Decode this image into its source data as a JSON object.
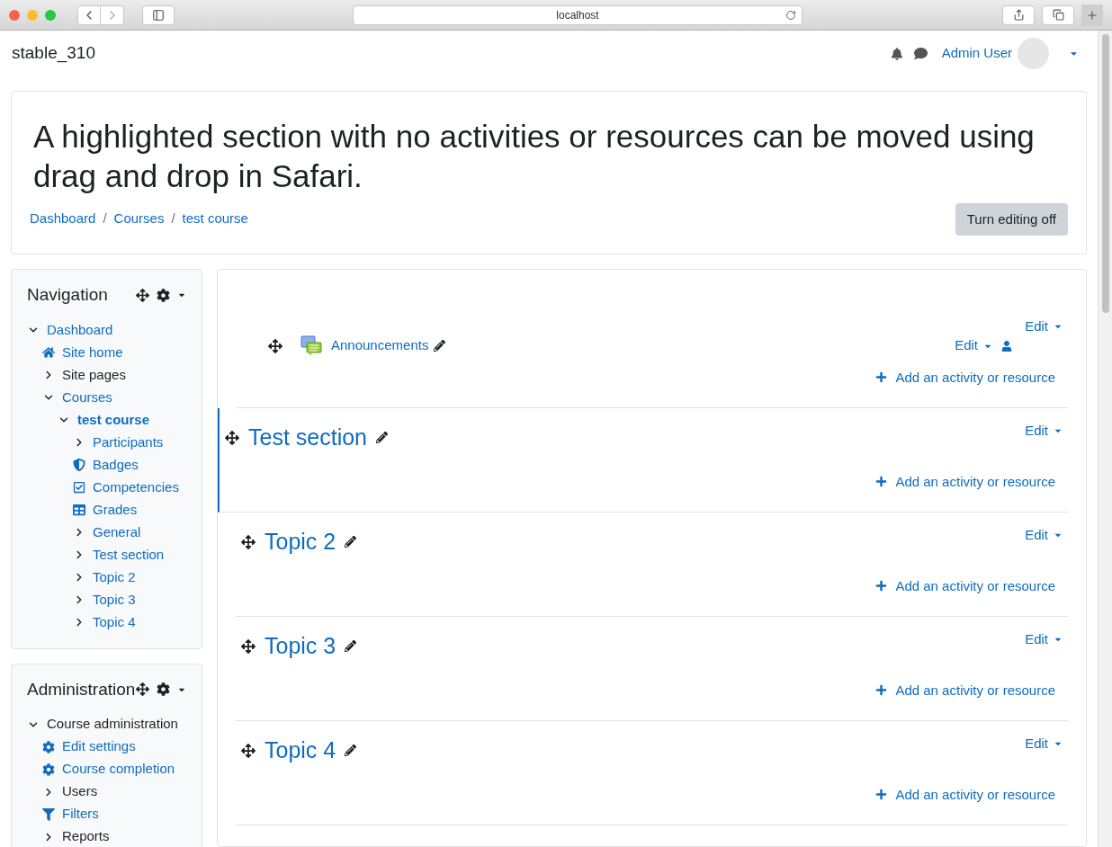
{
  "browser": {
    "address": "localhost"
  },
  "navbar": {
    "site_name": "stable_310",
    "user_name": "Admin User"
  },
  "header": {
    "title": "A highlighted section with no activities or resources can be moved using drag and drop in Safari.",
    "breadcrumbs": [
      "Dashboard",
      "Courses",
      "test course"
    ],
    "breadcrumb_separator": "/",
    "edit_button": "Turn editing off"
  },
  "navigation_block": {
    "title": "Navigation",
    "items": [
      {
        "label": "Dashboard",
        "kind": "branch",
        "expanded": true,
        "link": true,
        "current": false,
        "children": [
          {
            "label": "Site home",
            "kind": "home",
            "link": true,
            "current": false
          },
          {
            "label": "Site pages",
            "kind": "branch",
            "expanded": false,
            "link": false,
            "current": false
          },
          {
            "label": "Courses",
            "kind": "branch",
            "expanded": true,
            "link": true,
            "current": false,
            "children": [
              {
                "label": "test course",
                "kind": "branch",
                "expanded": true,
                "link": true,
                "current": true,
                "children": [
                  {
                    "label": "Participants",
                    "kind": "branch",
                    "expanded": false,
                    "link": true,
                    "current": false
                  },
                  {
                    "label": "Badges",
                    "kind": "badge",
                    "link": true,
                    "current": false
                  },
                  {
                    "label": "Competencies",
                    "kind": "check",
                    "link": true,
                    "current": false
                  },
                  {
                    "label": "Grades",
                    "kind": "table",
                    "link": true,
                    "current": false
                  },
                  {
                    "label": "General",
                    "kind": "branch",
                    "expanded": false,
                    "link": true,
                    "current": false
                  },
                  {
                    "label": "Test section",
                    "kind": "branch",
                    "expanded": false,
                    "link": true,
                    "current": false
                  },
                  {
                    "label": "Topic 2",
                    "kind": "branch",
                    "expanded": false,
                    "link": true,
                    "current": false
                  },
                  {
                    "label": "Topic 3",
                    "kind": "branch",
                    "expanded": false,
                    "link": true,
                    "current": false
                  },
                  {
                    "label": "Topic 4",
                    "kind": "branch",
                    "expanded": false,
                    "link": true,
                    "current": false
                  }
                ]
              }
            ]
          }
        ]
      }
    ]
  },
  "administration_block": {
    "title": "Administration",
    "items": [
      {
        "label": "Course administration",
        "kind": "branch",
        "expanded": true,
        "link": false,
        "current": false,
        "children": [
          {
            "label": "Edit settings",
            "kind": "gear",
            "link": true,
            "current": false
          },
          {
            "label": "Course completion",
            "kind": "gear",
            "link": true,
            "current": false
          },
          {
            "label": "Users",
            "kind": "branch",
            "expanded": false,
            "link": false,
            "current": false
          },
          {
            "label": "Filters",
            "kind": "filter",
            "link": true,
            "current": false
          },
          {
            "label": "Reports",
            "kind": "branch",
            "expanded": false,
            "link": false,
            "current": false
          }
        ]
      }
    ]
  },
  "sections": [
    {
      "highlighted": false,
      "edit": "Edit",
      "activities": [
        {
          "name": "Announcements",
          "edit": "Edit"
        }
      ],
      "add": "Add an activity or resource"
    },
    {
      "title": "Test section",
      "highlighted": true,
      "edit": "Edit",
      "add": "Add an activity or resource"
    },
    {
      "title": "Topic 2",
      "highlighted": false,
      "edit": "Edit",
      "add": "Add an activity or resource"
    },
    {
      "title": "Topic 3",
      "highlighted": false,
      "edit": "Edit",
      "add": "Add an activity or resource"
    },
    {
      "title": "Topic 4",
      "highlighted": false,
      "edit": "Edit",
      "add": "Add an activity or resource"
    }
  ]
}
